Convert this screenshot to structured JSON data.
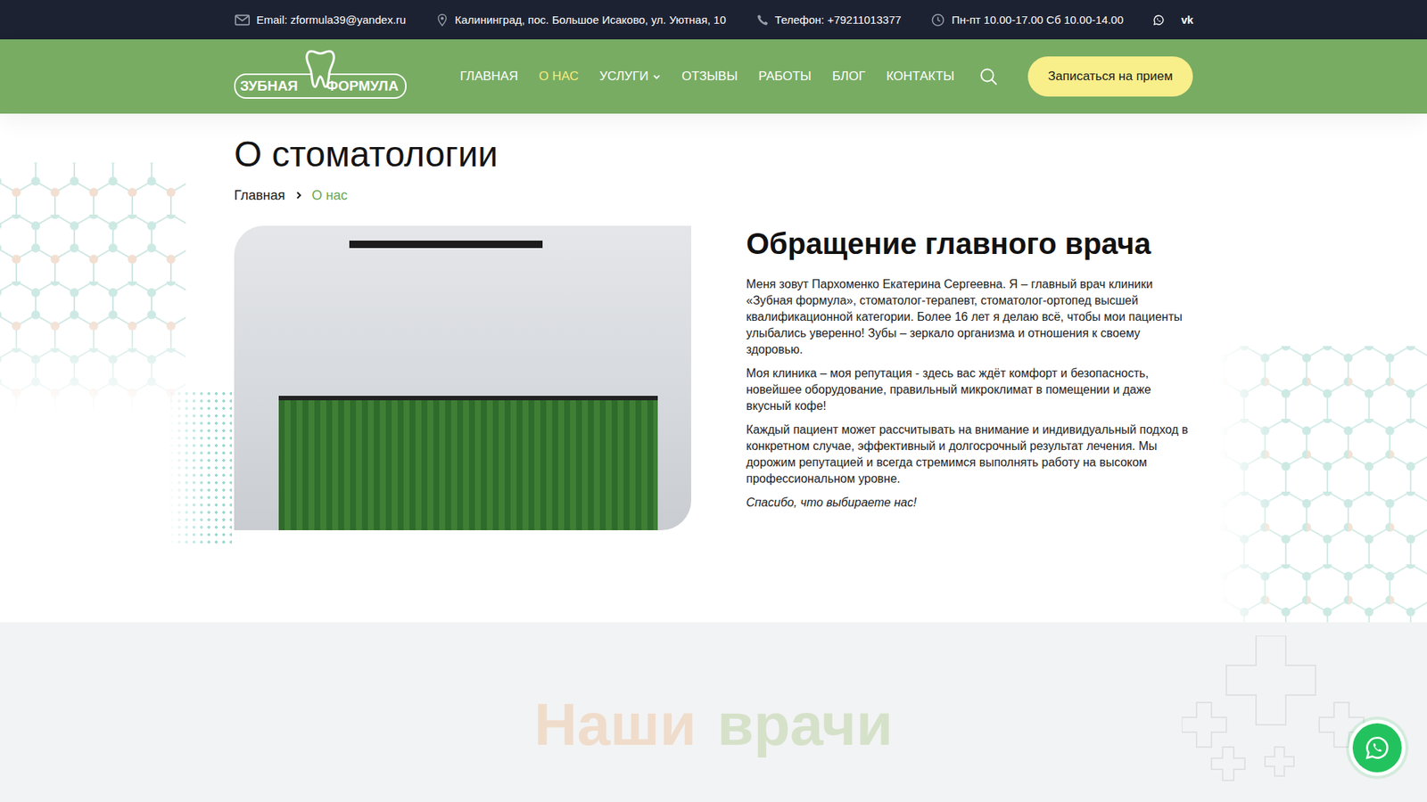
{
  "topbar": {
    "email": "Email: zformula39@yandex.ru",
    "address": "Калининград, пос. Большое Исаково, ул. Уютная, 10",
    "phone": "Телефон: +79211013377",
    "hours": "Пн-пт 10.00-17.00 Сб 10.00-14.00",
    "social": [
      {
        "kind": "whatsapp",
        "glyph": ""
      },
      {
        "kind": "vk",
        "glyph": "vk"
      }
    ]
  },
  "logo": {
    "left": "ЗУБНАЯ",
    "right": "ФОРМУЛА"
  },
  "nav": [
    {
      "label": "ГЛАВНАЯ",
      "selected": false,
      "dropdown": false
    },
    {
      "label": "О НАС",
      "selected": true,
      "dropdown": false
    },
    {
      "label": "УСЛУГИ",
      "selected": false,
      "dropdown": true
    },
    {
      "label": "ОТЗЫВЫ",
      "selected": false,
      "dropdown": false
    },
    {
      "label": "РАБОТЫ",
      "selected": false,
      "dropdown": false
    },
    {
      "label": "БЛОГ",
      "selected": false,
      "dropdown": false
    },
    {
      "label": "КОНТАКТЫ",
      "selected": false,
      "dropdown": false
    }
  ],
  "cta": "Записаться на прием",
  "page_title": "О стоматологии",
  "breadcrumbs": [
    {
      "label": "Главная",
      "current": false
    },
    {
      "label": "О нас",
      "current": true
    }
  ],
  "article": {
    "heading": "Обращение главного врача",
    "paragraphs": [
      "Меня зовут Пархоменко Екатерина Сергеевна. Я – главный врач клиники «Зубная формула», стоматолог-терапевт, стоматолог-ортопед высшей квалификационной категории. Более 16 лет я делаю всё, чтобы мои пациенты улыбались уверенно! Зубы – зеркало организма и отношения к своему здоровью.",
      "Моя клиника – моя репутация - здесь вас ждёт комфорт и безопасность, новейшее оборудование, правильный микроклимат в помещении и даже вкусный кофе!",
      "Каждый пациент может рассчитывать на внимание и индивидуальный подход в конкретном случае, эффективный и долгосрочный результат лечения. Мы дорожим репутацией и всегда стремимся выполнять работу на высоком профессиональном уровне."
    ],
    "signature": "Спасибо, что выбираете нас!"
  },
  "doctors_section": {
    "title_parts": [
      "Наши",
      "врачи"
    ]
  }
}
